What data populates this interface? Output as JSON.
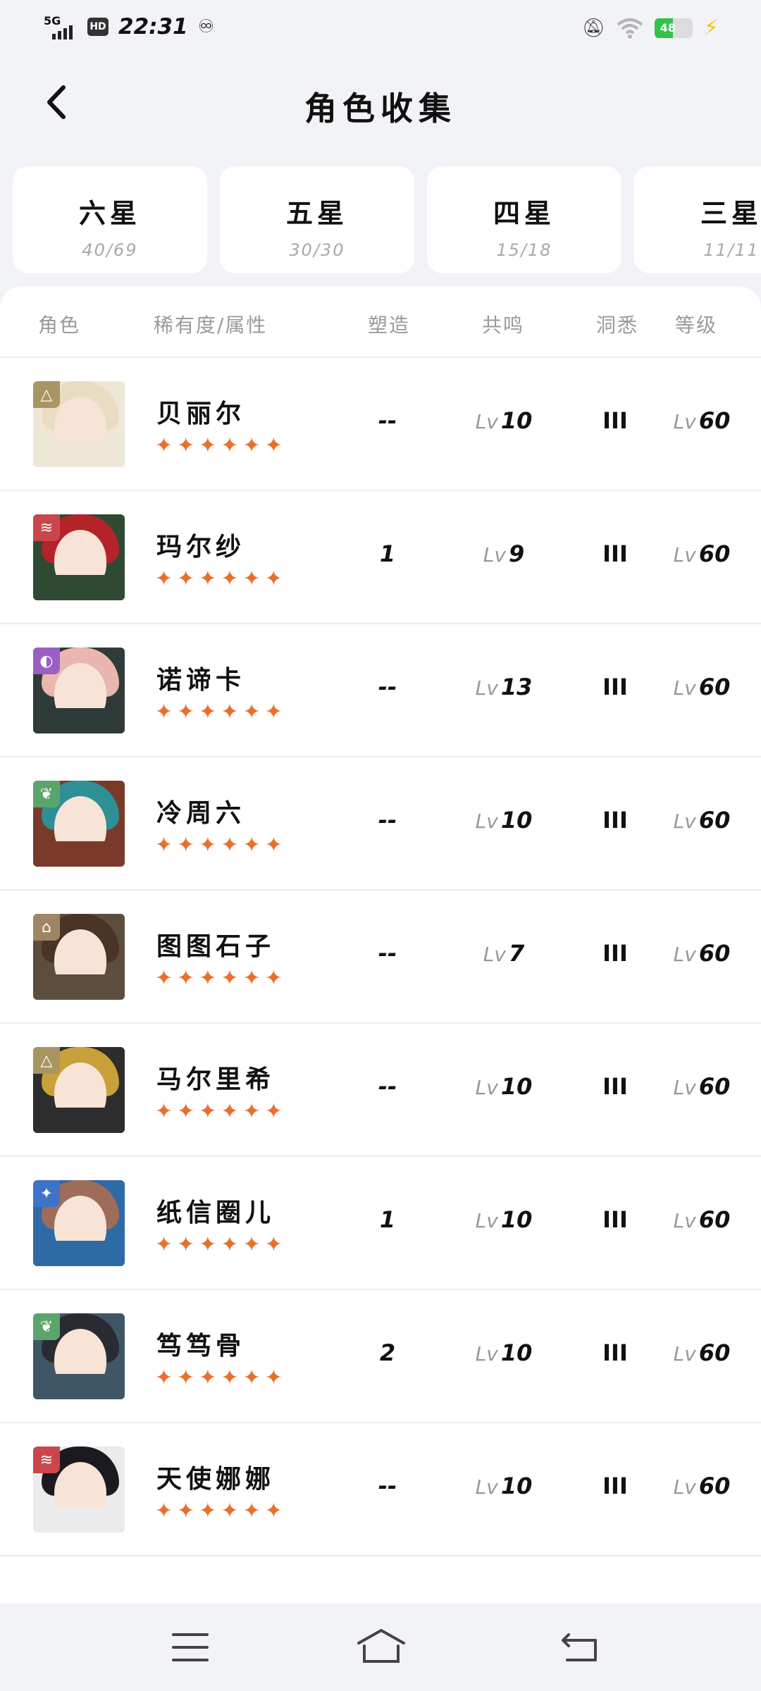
{
  "status_bar": {
    "network": "5G",
    "hd": "HD",
    "time": "22:31",
    "battery": "48",
    "icons": [
      "signal-icon",
      "hd-icon",
      "weibo-icon",
      "mute-bell-icon",
      "wifi-icon",
      "battery-icon",
      "charging-bolt-icon"
    ]
  },
  "header": {
    "title": "角色收集"
  },
  "tabs": [
    {
      "label": "六星",
      "count": "40/69"
    },
    {
      "label": "五星",
      "count": "30/30"
    },
    {
      "label": "四星",
      "count": "15/18"
    },
    {
      "label": "三星",
      "count": "11/11"
    }
  ],
  "table": {
    "headers": {
      "character": "角色",
      "rarity": "稀有度/属性",
      "shape": "塑造",
      "resonance": "共鸣",
      "insight": "洞悉",
      "level": "等级"
    },
    "lv_prefix": "Lv",
    "rows": [
      {
        "name": "贝丽尔",
        "stars": 6,
        "shape": "--",
        "resonance": "10",
        "insight": "III",
        "level": "60",
        "attr_color": "#a99561",
        "attr_icon": "△"
      },
      {
        "name": "玛尔纱",
        "stars": 6,
        "shape": "1",
        "resonance": "9",
        "insight": "III",
        "level": "60",
        "attr_color": "#c9474a",
        "attr_icon": "≋"
      },
      {
        "name": "诺谛卡",
        "stars": 6,
        "shape": "--",
        "resonance": "13",
        "insight": "III",
        "level": "60",
        "attr_color": "#9a5fc4",
        "attr_icon": "◐"
      },
      {
        "name": "冷周六",
        "stars": 6,
        "shape": "--",
        "resonance": "10",
        "insight": "III",
        "level": "60",
        "attr_color": "#5aa56b",
        "attr_icon": "❦"
      },
      {
        "name": "图图石子",
        "stars": 6,
        "shape": "--",
        "resonance": "7",
        "insight": "III",
        "level": "60",
        "attr_color": "#a08565",
        "attr_icon": "⌂"
      },
      {
        "name": "马尔里希",
        "stars": 6,
        "shape": "--",
        "resonance": "10",
        "insight": "III",
        "level": "60",
        "attr_color": "#a99561",
        "attr_icon": "△"
      },
      {
        "name": "纸信圈儿",
        "stars": 6,
        "shape": "1",
        "resonance": "10",
        "insight": "III",
        "level": "60",
        "attr_color": "#3f72c9",
        "attr_icon": "✦"
      },
      {
        "name": "笃笃骨",
        "stars": 6,
        "shape": "2",
        "resonance": "10",
        "insight": "III",
        "level": "60",
        "attr_color": "#5aa56b",
        "attr_icon": "❦"
      },
      {
        "name": "天使娜娜",
        "stars": 6,
        "shape": "--",
        "resonance": "10",
        "insight": "III",
        "level": "60",
        "attr_color": "#c9474a",
        "attr_icon": "≋"
      }
    ]
  },
  "nav": {
    "icons": [
      "menu-icon",
      "home-icon",
      "back-icon"
    ]
  },
  "colors": {
    "star": "#ea6f2a",
    "background": "#f2f3f7"
  }
}
